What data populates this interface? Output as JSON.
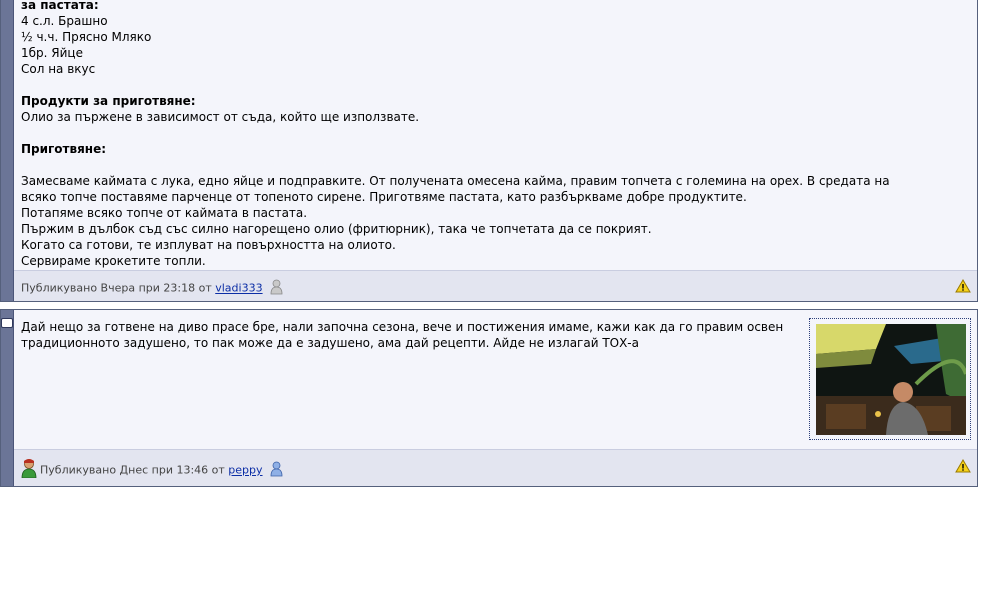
{
  "post1": {
    "lines_top": [
      {
        "text": "за пастата:",
        "bold": true
      },
      {
        "text": "4 с.л. Брашно",
        "bold": false
      },
      {
        "text": "½ ч.ч. Прясно Мляко",
        "bold": false
      },
      {
        "text": "1бр. Яйце",
        "bold": false
      },
      {
        "text": "Сол на вкус",
        "bold": false
      }
    ],
    "products_heading": "Продукти за приготвяне:",
    "products_text": "Олио за пържене в зависимост от съда, който ще използвате.",
    "prep_heading": "Приготвяне:",
    "prep_lines": [
      "Замесваме каймата с лука, едно яйце и подправките. От получената омесена кайма, правим топчета с големина на орех. В средата на",
      "всяко топче поставяме парченце от топеното сирене. Приготвяме пастата, като разбъркваме добре продуктите.",
      "Потапяме всяко топче от каймата в пастата.",
      "Пържим в дълбок съд със силно нагорещено олио (фритюрник), така че топчетата да се покрият.",
      "Когато са готови, те изплуват на повърхността на олиото.",
      "Сервираме крокетите топли."
    ],
    "footer": {
      "prefix": "Публикувано Вчера при 23:18 от",
      "author": "vladi333"
    }
  },
  "post2": {
    "text": "Дай нещо за готвене на диво прасе бре, нали започна сезона, вече и постижения имаме, кажи как да го правим освен традиционното задушено, то пак може да е задушено, ама дай рецепти. Айде не излагай ТОХ-а",
    "footer": {
      "prefix": "Публикувано Днес при 13:46 от",
      "author": "peppy"
    }
  },
  "colors": {
    "frame": "#55607c",
    "sidebar": "#6b7597",
    "post_bg": "#f4f5fb",
    "footer_bg": "#e3e5f0",
    "link": "#0b2da6"
  },
  "icons": [
    "user-icon",
    "warning-icon",
    "avatar-icon",
    "comment-icon"
  ]
}
